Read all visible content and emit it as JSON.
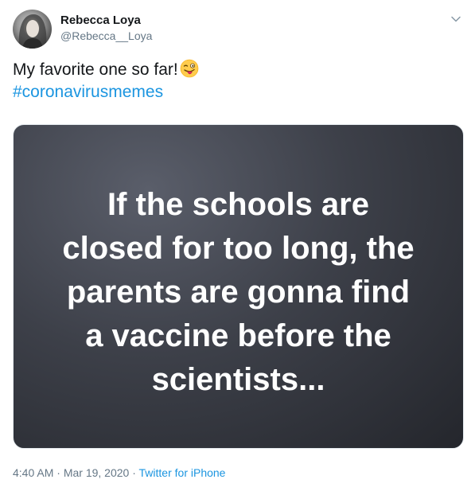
{
  "author": {
    "display_name": "Rebecca Loya",
    "handle": "@Rebecca__Loya"
  },
  "tweet": {
    "text": "My favorite one so far!",
    "emoji": "winking-face-with-tongue-icon",
    "hashtag": "#coronavirusmemes"
  },
  "media": {
    "lines": [
      "If the schools are",
      "closed for too long, the",
      "parents are gonna find",
      "a vaccine before the",
      "scientists..."
    ]
  },
  "meta": {
    "time": "4:40 AM",
    "separator1": "·",
    "date": "Mar 19, 2020",
    "separator2": "·",
    "source": "Twitter for iPhone"
  },
  "colors": {
    "link": "#1b95e0",
    "muted": "#657786",
    "text": "#14171a"
  }
}
